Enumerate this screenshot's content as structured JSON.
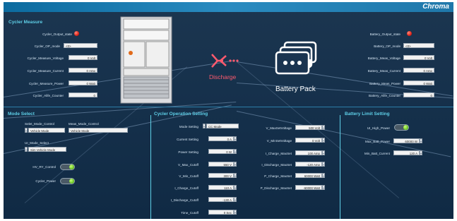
{
  "brand": "Chroma",
  "cycler_measure": {
    "title": "Cycler Measure",
    "output_state_label": "Cycler_Output_state",
    "op_mode_label": "Cycler_OP_mode",
    "op_mode_value": "<0>",
    "voltage_label": "Cycler_Measure_Voltage",
    "voltage_value": "0 Volt",
    "current_label": "Cycler_Measure_Current",
    "current_value": "0 Amp",
    "power_label": "Cycler_Measure_Power",
    "power_value": "0 Watt",
    "alife_label": "Cycler_Alife_Counter",
    "alife_value": "0"
  },
  "center": {
    "discharge_label": "Discharge",
    "pack_label": "Battery Pack"
  },
  "battery_measure": {
    "output_state_label": "Battery_Output_state",
    "op_mode_label": "Battery_OP_mode",
    "op_mode_value": "<0>",
    "voltage_label": "Battery_Meas_Voltage",
    "voltage_value": "0 Volt",
    "current_label": "Battery_Meas_Current",
    "current_value": "0 Amp",
    "power_label": "Battery_Meas_Power",
    "power_value": "0 Watt",
    "alife_label": "Battery_Alife_Counter",
    "alife_value": "0"
  },
  "mode_select": {
    "title": "Mode Select",
    "select_label": "Selet_Mode_Control",
    "select_value": "Vehicle Mode",
    "meas_label": "Meas_Mode_Control",
    "meas_value": "Vehicle Mode",
    "ui_label": "UI_Mode_Select",
    "ui_value": "Sim Vehicle Mode",
    "hv_label": "HV_RY_Control",
    "power_label": "Cycler_Power"
  },
  "op_setting": {
    "title": "Cycler Operation Setting",
    "left": [
      {
        "label": "Mode Setting",
        "value": "CC Mode"
      },
      {
        "label": "Current Setting",
        "value": "0 A"
      },
      {
        "label": "Power Setting",
        "value": "0 W"
      },
      {
        "label": "V_Max_Cutoff",
        "value": "550 V"
      },
      {
        "label": "V_Min_Cutoff",
        "value": "300 V"
      },
      {
        "label": "I_Charge_Cutoff",
        "value": "110 A"
      },
      {
        "label": "I_Discharge_Cutoff",
        "value": "-130 A"
      },
      {
        "label": "Time_Cutoff",
        "value": "0 Sec"
      }
    ],
    "right": [
      {
        "label": "V_MaxSetVoltage",
        "value": "500 Volt"
      },
      {
        "label": "V_MinSetVoltage",
        "value": "0 Volt"
      },
      {
        "label": "I_Charge_MaxSet",
        "value": "100 Amp"
      },
      {
        "label": "I_Discharge_MaxSet",
        "value": "-120 Amp"
      },
      {
        "label": "P_Charge_MaxSet",
        "value": "60000 Watt"
      },
      {
        "label": "P_Discharge_MaxSet",
        "value": "-60000 Watt"
      }
    ]
  },
  "battery_limit": {
    "title": "Battery Limit Setting",
    "ui_high_power_label": "UI_High_Power",
    "max_power_label": "Max_Batt_Power",
    "max_power_value": "60000 W",
    "min_current_label": "Min_Batt_Current",
    "min_current_value": "120 A"
  },
  "colors": {
    "accent": "#5fd0e8",
    "led_red": "#e0241a",
    "toggle_green": "#63c21c",
    "discharge": "#ff5a6e",
    "titlebar": "#1f78aa"
  }
}
